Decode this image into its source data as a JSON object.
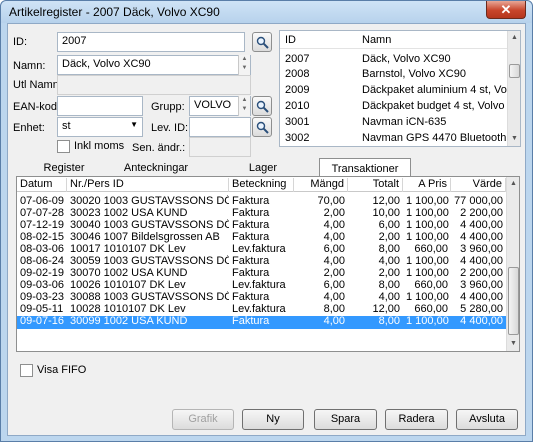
{
  "window": {
    "title": "Artikelregister - 2007 Däck, Volvo XC90",
    "close_glyph": "✕"
  },
  "form": {
    "id_label": "ID:",
    "id_value": "2007",
    "namn_label": "Namn:",
    "namn_value": "Däck, Volvo XC90",
    "utl_namn_label": "Utl Namn:",
    "utl_namn_value": "",
    "ean_label": "EAN-kod:",
    "ean_value": "",
    "grupp_label": "Grupp:",
    "grupp_value": "VOLVO",
    "enhet_label": "Enhet:",
    "enhet_value": "st",
    "lev_id_label": "Lev. ID:",
    "lev_id_value": "",
    "inkl_moms_label": "Inkl moms",
    "sen_andr_label": "Sen. ändr.:",
    "sen_andr_value": ""
  },
  "article_list": {
    "headers": {
      "id": "ID",
      "namn": "Namn"
    },
    "rows": [
      {
        "id": "2007",
        "namn": "Däck, Volvo XC90"
      },
      {
        "id": "2008",
        "namn": "Barnstol, Volvo XC90"
      },
      {
        "id": "2009",
        "namn": "Däckpaket aluminium 4 st, Volvo XC"
      },
      {
        "id": "2010",
        "namn": "Däckpaket budget 4 st, Volvo XC90"
      },
      {
        "id": "3001",
        "namn": "Navman iCN-635"
      },
      {
        "id": "3002",
        "namn": "Navman GPS 4470 Bluetooth"
      }
    ]
  },
  "tabs": [
    {
      "label": "Register"
    },
    {
      "label": "Anteckningar"
    },
    {
      "label": "Lager"
    },
    {
      "label": "Transaktioner"
    }
  ],
  "grid": {
    "headers": {
      "datum": "Datum",
      "nr": "Nr./Pers ID",
      "beteckning": "Beteckning",
      "mangd": "Mängd",
      "totalt": "Totalt",
      "apris": "A Pris",
      "varde": "Värde"
    },
    "rows": [
      {
        "datum": "07-06-09",
        "nr": "30020 1003 GUSTAVSSONS DÖDSBO",
        "beteckning": "Faktura",
        "mangd": "70,00",
        "totalt": "12,00",
        "apris": "1 100,00",
        "varde": "77 000,00"
      },
      {
        "datum": "07-07-28",
        "nr": "30023 1002 USA KUND",
        "beteckning": "Faktura",
        "mangd": "2,00",
        "totalt": "10,00",
        "apris": "1 100,00",
        "varde": "2 200,00"
      },
      {
        "datum": "07-12-19",
        "nr": "30040 1003 GUSTAVSSONS DÖDSBO",
        "beteckning": "Faktura",
        "mangd": "4,00",
        "totalt": "6,00",
        "apris": "1 100,00",
        "varde": "4 400,00"
      },
      {
        "datum": "08-02-15",
        "nr": "30046 1007 Bildelsgrossen AB",
        "beteckning": "Faktura",
        "mangd": "4,00",
        "totalt": "2,00",
        "apris": "1 100,00",
        "varde": "4 400,00"
      },
      {
        "datum": "08-03-06",
        "nr": "10017 1010107 DK Lev",
        "beteckning": "Lev.faktura",
        "mangd": "6,00",
        "totalt": "8,00",
        "apris": "660,00",
        "varde": "3 960,00"
      },
      {
        "datum": "08-06-24",
        "nr": "30059 1003 GUSTAVSSONS DÖDSBO",
        "beteckning": "Faktura",
        "mangd": "4,00",
        "totalt": "4,00",
        "apris": "1 100,00",
        "varde": "4 400,00"
      },
      {
        "datum": "09-02-19",
        "nr": "30070 1002 USA KUND",
        "beteckning": "Faktura",
        "mangd": "2,00",
        "totalt": "2,00",
        "apris": "1 100,00",
        "varde": "2 200,00"
      },
      {
        "datum": "09-03-06",
        "nr": "10026 1010107 DK Lev",
        "beteckning": "Lev.faktura",
        "mangd": "6,00",
        "totalt": "8,00",
        "apris": "660,00",
        "varde": "3 960,00"
      },
      {
        "datum": "09-03-23",
        "nr": "30088 1003 GUSTAVSSONS DÖDSBO",
        "beteckning": "Faktura",
        "mangd": "4,00",
        "totalt": "4,00",
        "apris": "1 100,00",
        "varde": "4 400,00"
      },
      {
        "datum": "09-05-11",
        "nr": "10028 1010107 DK Lev",
        "beteckning": "Lev.faktura",
        "mangd": "8,00",
        "totalt": "12,00",
        "apris": "660,00",
        "varde": "5 280,00"
      },
      {
        "datum": "09-07-16",
        "nr": "30099 1002 USA KUND",
        "beteckning": "Faktura",
        "mangd": "4,00",
        "totalt": "8,00",
        "apris": "1 100,00",
        "varde": "4 400,00",
        "selected": true
      }
    ]
  },
  "options": {
    "visa_fifo_label": "Visa FIFO"
  },
  "buttons": {
    "grafik": "Grafik",
    "ny": "Ny",
    "spara": "Spara",
    "radera": "Radera",
    "avsluta": "Avsluta"
  },
  "colors": {
    "selection": "#3399ff",
    "frame": "#bcd6ee",
    "close": "#c8452b"
  },
  "icons": {
    "search": "search-icon",
    "dropdown": "chevron-down-icon",
    "spin": "spin-arrows-icon"
  }
}
